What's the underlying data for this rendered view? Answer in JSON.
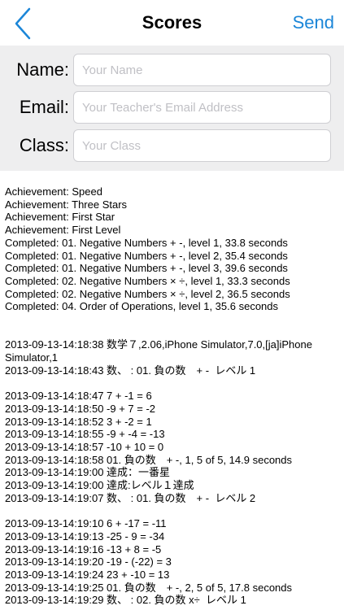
{
  "navbar": {
    "title": "Scores",
    "send_label": "Send",
    "accent": "#1b86d8"
  },
  "form": {
    "name": {
      "label": "Name:",
      "placeholder": "Your Name",
      "value": ""
    },
    "email": {
      "label": "Email:",
      "placeholder": "Your Teacher's Email Address",
      "value": ""
    },
    "class": {
      "label": "Class:",
      "placeholder": "Your Class",
      "value": ""
    }
  },
  "log": {
    "lines": [
      "Achievement: Speed",
      "Achievement: Three Stars",
      "Achievement: First Star",
      "Achievement: First Level",
      "Completed: 01. Negative Numbers + -, level 1, 33.8 seconds",
      "Completed: 01. Negative Numbers + -, level 2, 35.4 seconds",
      "Completed: 01. Negative Numbers + -, level 3, 39.6 seconds",
      "Completed: 02. Negative Numbers × ÷, level 1, 33.3 seconds",
      "Completed: 02. Negative Numbers × ÷, level 2, 36.5 seconds",
      "Completed: 04. Order of Operations, level 1, 35.6 seconds",
      "",
      "",
      "2013-09-13-14:18:38 数学７,2.06,iPhone Simulator,7.0,[ja]iPhone Simulator,1",
      "2013-09-13-14:18:43 数、 : 01. 負の数　+ -  レベル 1",
      "",
      "2013-09-13-14:18:47 7 + -1 = 6",
      "2013-09-13-14:18:50 -9 + 7 = -2",
      "2013-09-13-14:18:52 3 + -2 = 1",
      "2013-09-13-14:18:55 -9 + -4 = -13",
      "2013-09-13-14:18:57 -10 + 10 = 0",
      "2013-09-13-14:18:58 01. 負の数　+ -, 1, 5 of 5, 14.9 seconds",
      "2013-09-13-14:19:00 達成：一番星",
      "2013-09-13-14:19:00 達成:レベル１達成",
      "2013-09-13-14:19:07 数、 : 01. 負の数　+ -  レベル 2",
      "",
      "2013-09-13-14:19:10 6 + -17 = -11",
      "2013-09-13-14:19:13 -25 - 9 = -34",
      "2013-09-13-14:19:16 -13 + 8 = -5",
      "2013-09-13-14:19:20 -19 - (-22) = 3",
      "2013-09-13-14:19:24 23 + -10 = 13",
      "2013-09-13-14:19:25 01. 負の数　+ -, 2, 5 of 5, 17.8 seconds",
      "2013-09-13-14:19:29 数、 : 02. 負の数 x÷  レベル 1"
    ]
  }
}
